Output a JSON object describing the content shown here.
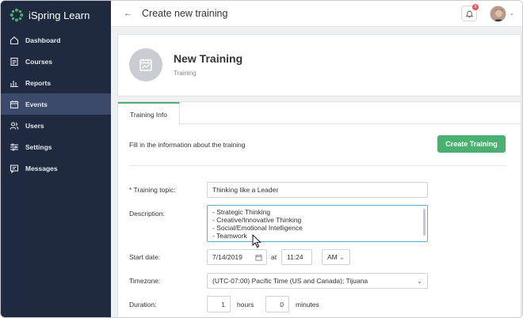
{
  "app": {
    "brand": "iSpring Learn",
    "brand_color": "#4caf72"
  },
  "sidebar": {
    "items": [
      {
        "label": "Dashboard",
        "icon": "home-icon"
      },
      {
        "label": "Courses",
        "icon": "courses-icon"
      },
      {
        "label": "Reports",
        "icon": "reports-icon"
      },
      {
        "label": "Events",
        "icon": "calendar-icon",
        "active": true
      },
      {
        "label": "Users",
        "icon": "users-icon"
      },
      {
        "label": "Settings",
        "icon": "settings-icon"
      },
      {
        "label": "Messages",
        "icon": "messages-icon"
      }
    ]
  },
  "topbar": {
    "title": "Create new training",
    "notifications": "8"
  },
  "header": {
    "title": "New Training",
    "subtitle": "Training"
  },
  "tabs": [
    {
      "label": "Training Info",
      "active": true
    }
  ],
  "form": {
    "intro": "Fill in the information about the training",
    "create_label": "Create Training",
    "topic_label": "* Training topic:",
    "topic_value": "Thinking like a Leader",
    "description_label": "Description:",
    "description_lines": [
      "- Strategic Thinking",
      "- Creative/Innovative Thinking",
      "- Social/Emotional Intelligence",
      "- Teamwork"
    ],
    "start_label": "Start date:",
    "start_date": "7/14/2019",
    "at_label": "at",
    "start_time": "11:24",
    "ampm": "AM",
    "timezone_label": "Timezone:",
    "timezone_value": "(UTC-07:00) Pacific Time (US and Canada); Tijuana",
    "duration_label": "Duration:",
    "duration_hours": "1",
    "hours_label": "hours",
    "duration_minutes": "0",
    "minutes_label": "minutes"
  }
}
